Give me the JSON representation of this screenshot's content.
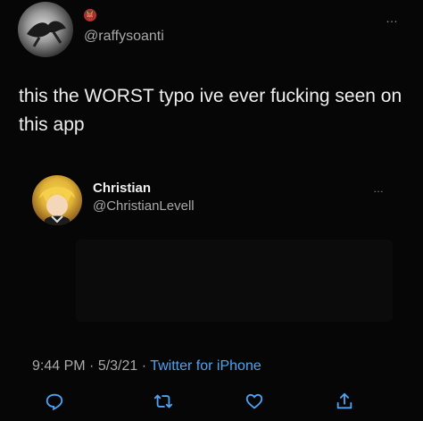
{
  "tweet": {
    "handle": "@raffysoanti",
    "badge_emoji": "👹",
    "text": "this the WORST typo ive ever fucking seen on this app",
    "more_icon": "…"
  },
  "quoted": {
    "name": "Christian",
    "handle": "@ChristianLevell",
    "more_icon": "…"
  },
  "meta": {
    "time": "9:44 PM",
    "sep1": " · ",
    "date": "5/3/21",
    "sep2": " · ",
    "source": "Twitter for iPhone"
  },
  "actions": [
    {
      "name": "reply",
      "icon": "reply-icon"
    },
    {
      "name": "retweet",
      "icon": "retweet-icon"
    },
    {
      "name": "like",
      "icon": "heart-icon"
    },
    {
      "name": "share",
      "icon": "share-icon"
    }
  ],
  "colors": {
    "background": "#060606",
    "text": "#efefef",
    "secondary": "#a9a9a9",
    "link": "#4ea3f2"
  }
}
